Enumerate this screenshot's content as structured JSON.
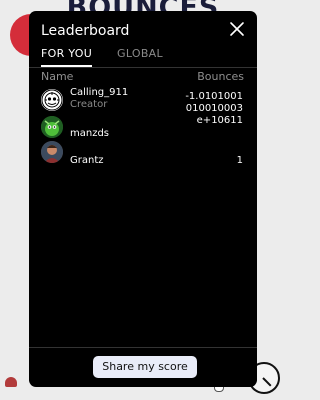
{
  "background": {
    "title": "BOUNCES"
  },
  "leaderboard": {
    "title": "Leaderboard",
    "close_icon": "close-icon",
    "tabs": [
      {
        "label": "FOR YOU",
        "active": true
      },
      {
        "label": "GLOBAL",
        "active": false
      }
    ],
    "columns": {
      "name": "Name",
      "bounces": "Bounces"
    },
    "rows": [
      {
        "name": "Calling_911",
        "role": "Creator",
        "bounces_lines": [
          "-1.0101001",
          "010010003",
          "e+10611"
        ],
        "avatar_icon": "ornate-emblem-avatar"
      },
      {
        "name": "manzds",
        "role": "",
        "bounces_lines": [],
        "avatar_icon": "green-creature-avatar"
      },
      {
        "name": "Grantz",
        "role": "",
        "bounces_lines": [
          "1"
        ],
        "avatar_icon": "photo-avatar"
      }
    ],
    "share_label": "Share my score"
  },
  "colors": {
    "panel_bg": "#000000",
    "share_bg": "#e9ecf8",
    "muted_text": "#8a8a8a",
    "red_circle": "#d42d3a"
  }
}
